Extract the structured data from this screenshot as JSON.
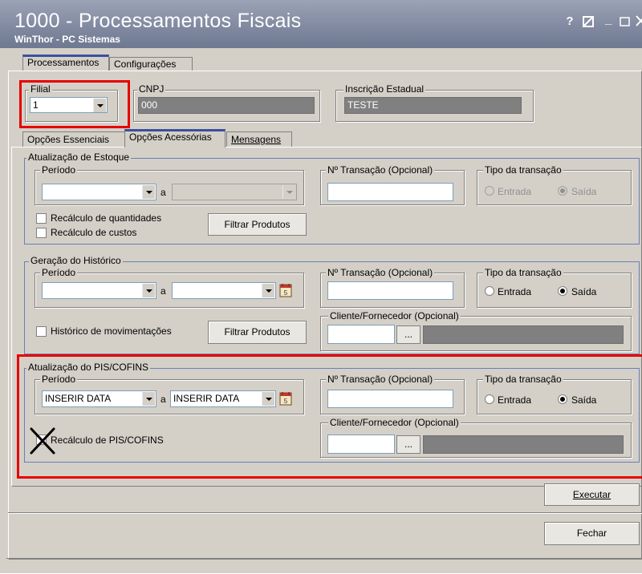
{
  "window": {
    "title": "1000 - Processamentos Fiscais",
    "subtitle": "WinThor - PC Sistemas",
    "controls": {
      "help": "?",
      "minimize": "_"
    }
  },
  "top_tabs": [
    {
      "label": "Processamentos"
    },
    {
      "label": "Configurações"
    }
  ],
  "filial": {
    "legend": "Filial",
    "value": "1"
  },
  "cnpj": {
    "legend": "CNPJ",
    "value": "000"
  },
  "inscricao": {
    "legend": "Inscrição Estadual",
    "value": "TESTE"
  },
  "sub_tabs": [
    {
      "label": "Opções Essenciais"
    },
    {
      "label": "Opções Acessórias"
    },
    {
      "label": "Mensagens"
    }
  ],
  "estoque": {
    "legend": "Atualização de Estoque",
    "periodo_legend": "Período",
    "date_from": "",
    "a_label": "a",
    "date_to": "",
    "transacao_legend": "Nº Transação (Opcional)",
    "transacao_value": "",
    "tipo_legend": "Tipo da transação",
    "entrada_label": "Entrada",
    "saida_label": "Saída",
    "selected": "Saída",
    "recalc_qty_label": "Recálculo de quantidades",
    "recalc_cost_label": "Recálculo de custos",
    "filtrar_label": "Filtrar Produtos"
  },
  "historico": {
    "legend": "Geração do Histórico",
    "periodo_legend": "Período",
    "date_from": "",
    "a_label": "a",
    "date_to": "",
    "transacao_legend": "Nº Transação (Opcional)",
    "transacao_value": "",
    "tipo_legend": "Tipo da transação",
    "entrada_label": "Entrada",
    "saida_label": "Saída",
    "selected": "Saída",
    "cliente_legend": "Cliente/Fornecedor (Opcional)",
    "cliente_code": "",
    "ellipsis": "...",
    "hist_mov_label": "Histórico de movimentações",
    "filtrar_label": "Filtrar Produtos"
  },
  "pis": {
    "legend": "Atualização do PIS/COFINS",
    "periodo_legend": "Período",
    "date_from": "INSERIR DATA",
    "a_label": "a",
    "date_to": "INSERIR DATA",
    "transacao_legend": "Nº Transação (Opcional)",
    "transacao_value": "",
    "tipo_legend": "Tipo da transação",
    "entrada_label": "Entrada",
    "saida_label": "Saída",
    "selected": "Saída",
    "cliente_legend": "Cliente/Fornecedor (Opcional)",
    "cliente_code": "",
    "ellipsis": "...",
    "recalc_label": "Recálculo de PIS/COFINS"
  },
  "actions": {
    "executar": "Executar",
    "fechar": "Fechar"
  },
  "colors": {
    "highlight": "#e60000",
    "window_bg": "#d4d0c8",
    "title_bg": "#8089a0",
    "tab_accent": "#3a4fa0"
  },
  "icons": [
    "calendar-icon",
    "dropdown-arrow-icon",
    "cross-mark-icon",
    "maximize-icon",
    "restore-icon",
    "close-icon"
  ]
}
